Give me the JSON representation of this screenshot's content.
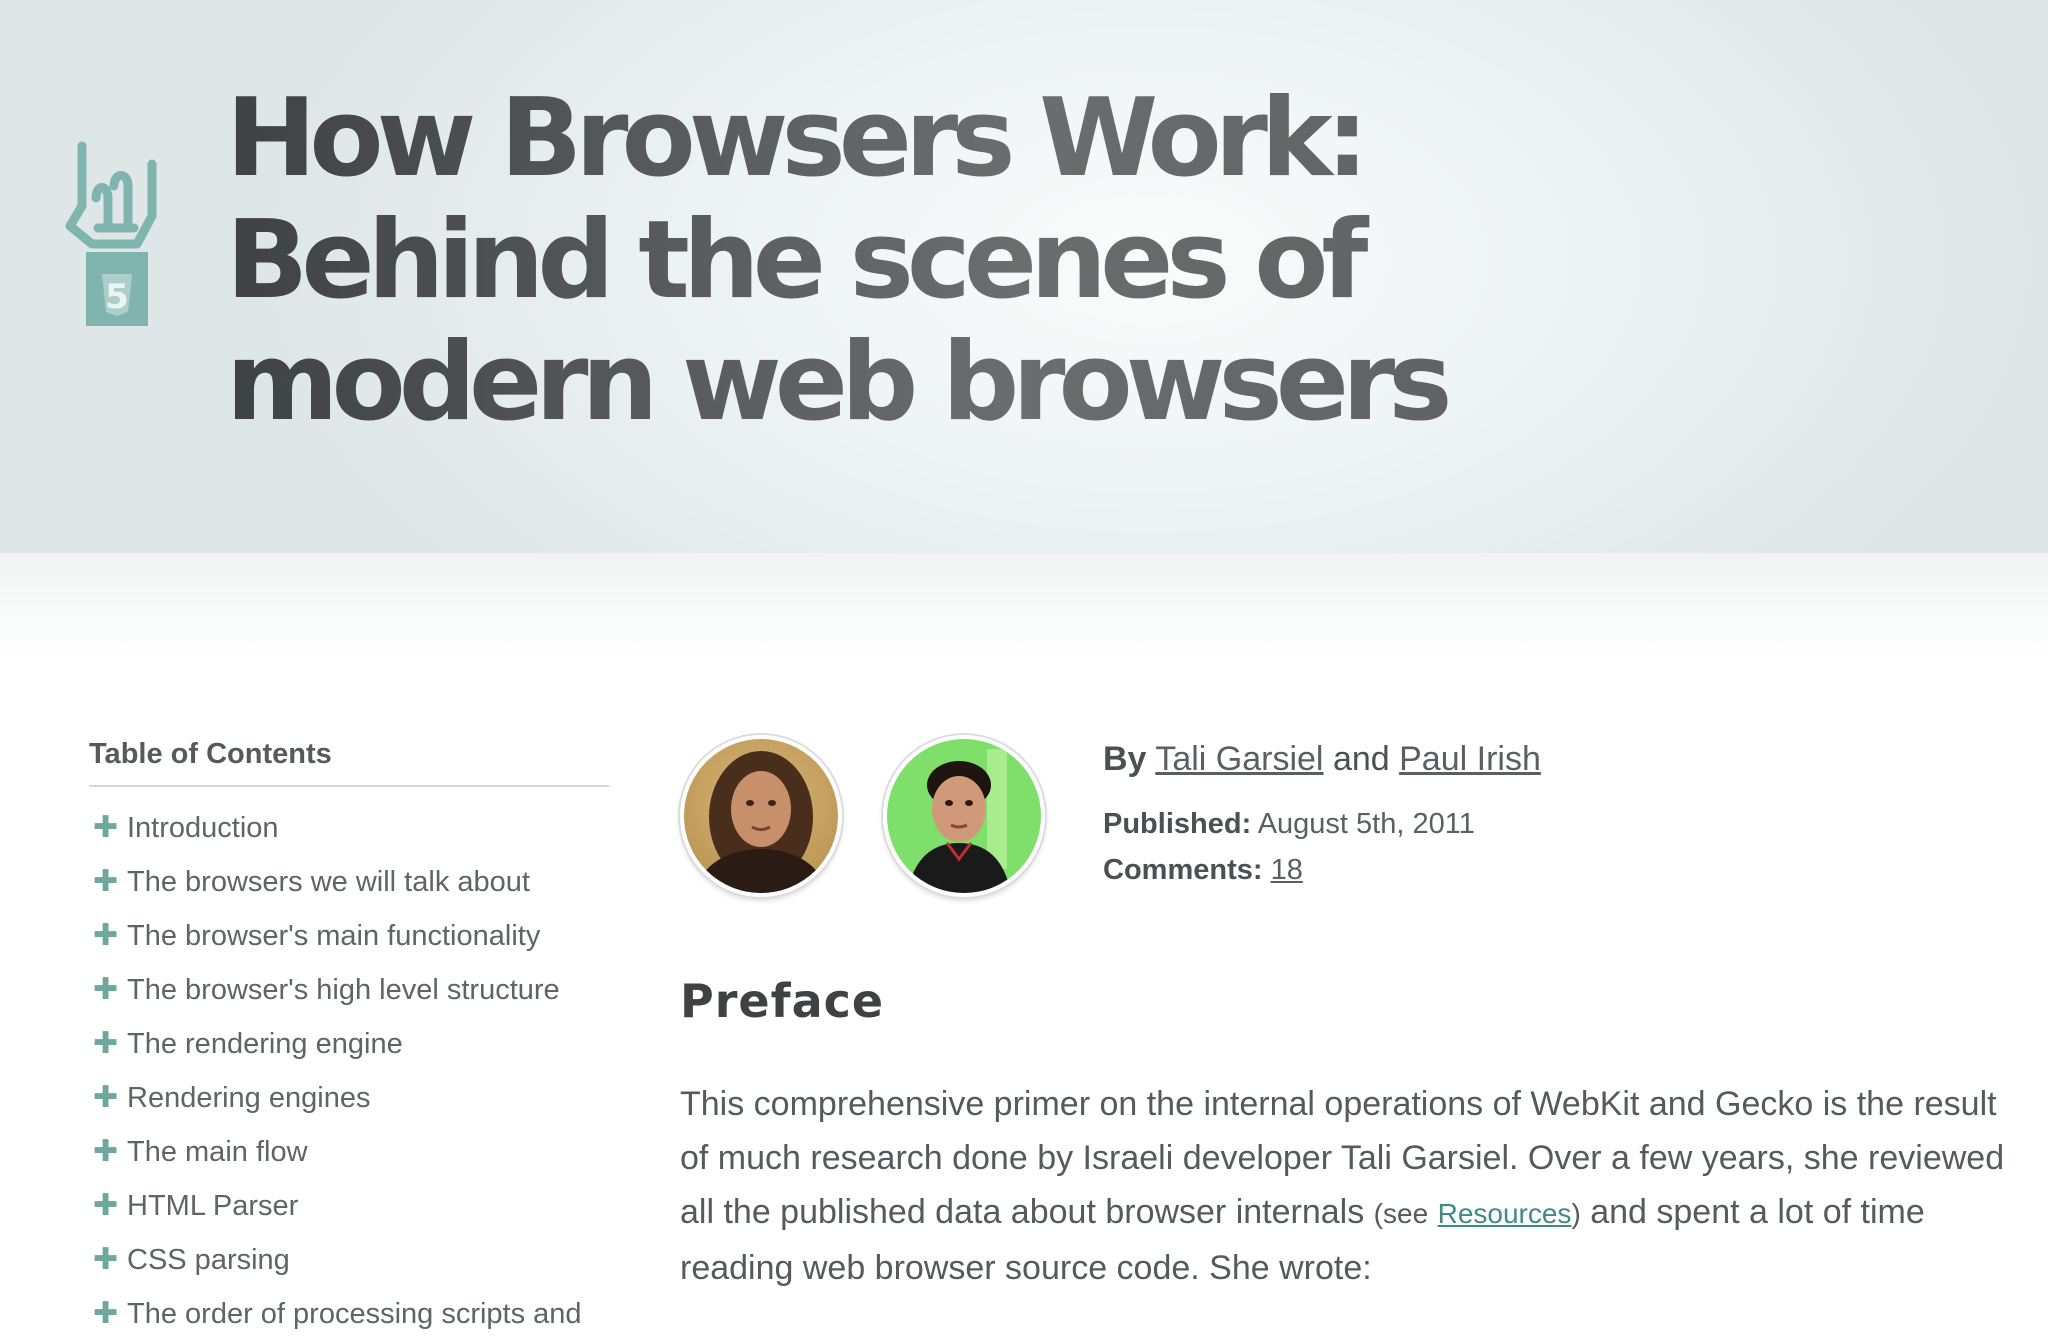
{
  "header": {
    "title": "How Browsers Work: Behind the scenes of modern web browsers",
    "logo_icon": "html5-rock-hand-icon",
    "logo_badge_text": "5",
    "accent_color": "#7fb3ad"
  },
  "toc": {
    "heading": "Table of Contents",
    "bullet_glyph": "✚",
    "items": [
      "Introduction",
      "The browsers we will talk about",
      "The browser's main functionality",
      "The browser's high level structure",
      "The rendering engine",
      "Rendering engines",
      "The main flow",
      "HTML Parser",
      "CSS parsing",
      "The order of processing scripts and"
    ]
  },
  "authors": {
    "by_label": "By",
    "author1": "Tali Garsiel",
    "and_label": "and",
    "author2": "Paul Irish",
    "published_label": "Published:",
    "published_date": "August 5th, 2011",
    "comments_label": "Comments:",
    "comments_count": "18"
  },
  "preface": {
    "heading": "Preface",
    "text_before": "This comprehensive primer on the internal operations of WebKit and Gecko is the result of much research done by Israeli developer Tali Garsiel. Over a few years, she reviewed all the published data about browser internals",
    "see_label": "(see",
    "resources_link": "Resources",
    "close_paren": ")",
    "text_after": " and spent a lot of time reading web browser source code. She wrote:"
  }
}
